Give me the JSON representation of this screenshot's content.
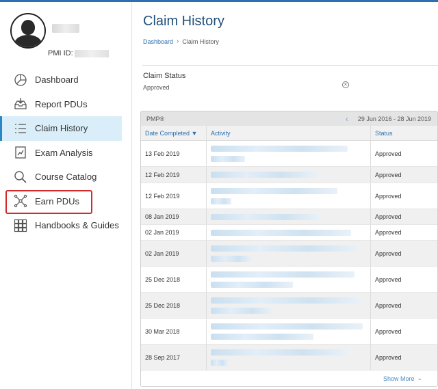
{
  "sidebar": {
    "pmi_id_label": "PMI ID:",
    "items": [
      {
        "label": "Dashboard",
        "icon": "pie-chart-icon"
      },
      {
        "label": "Report PDUs",
        "icon": "inbox-download-icon"
      },
      {
        "label": "Claim History",
        "icon": "list-icon",
        "active": true
      },
      {
        "label": "Exam Analysis",
        "icon": "chart-document-icon"
      },
      {
        "label": "Course Catalog",
        "icon": "search-icon"
      },
      {
        "label": "Earn PDUs",
        "icon": "network-icon",
        "highlighted": true
      },
      {
        "label": "Handbooks & Guides",
        "icon": "grid-icon"
      }
    ]
  },
  "page": {
    "title": "Claim History",
    "breadcrumb": [
      "Dashboard",
      "Claim History"
    ]
  },
  "filter": {
    "label": "Claim Status",
    "value": "Approved"
  },
  "table": {
    "certification": "PMP®",
    "date_range": "29 Jun 2016 - 28 Jun 2019",
    "headers": [
      "Date Completed ▼",
      "Activity",
      "Status"
    ],
    "rows": [
      {
        "date": "13 Feb 2019",
        "status": "Approved"
      },
      {
        "date": "12 Feb 2019",
        "status": "Approved"
      },
      {
        "date": "12 Feb 2019",
        "status": "Approved"
      },
      {
        "date": "08 Jan 2019",
        "status": "Approved"
      },
      {
        "date": "02 Jan 2019",
        "status": "Approved"
      },
      {
        "date": "02 Jan 2019",
        "status": "Approved"
      },
      {
        "date": "25 Dec 2018",
        "status": "Approved"
      },
      {
        "date": "25 Dec 2018",
        "status": "Approved"
      },
      {
        "date": "30 Mar 2018",
        "status": "Approved"
      },
      {
        "date": "28 Sep 2017",
        "status": "Approved"
      }
    ],
    "show_more": "Show More"
  },
  "colors": {
    "accent": "#2a86c4",
    "title": "#1f4f7a",
    "active_bg": "#d9eef8",
    "highlight_border": "#d32b2b"
  }
}
